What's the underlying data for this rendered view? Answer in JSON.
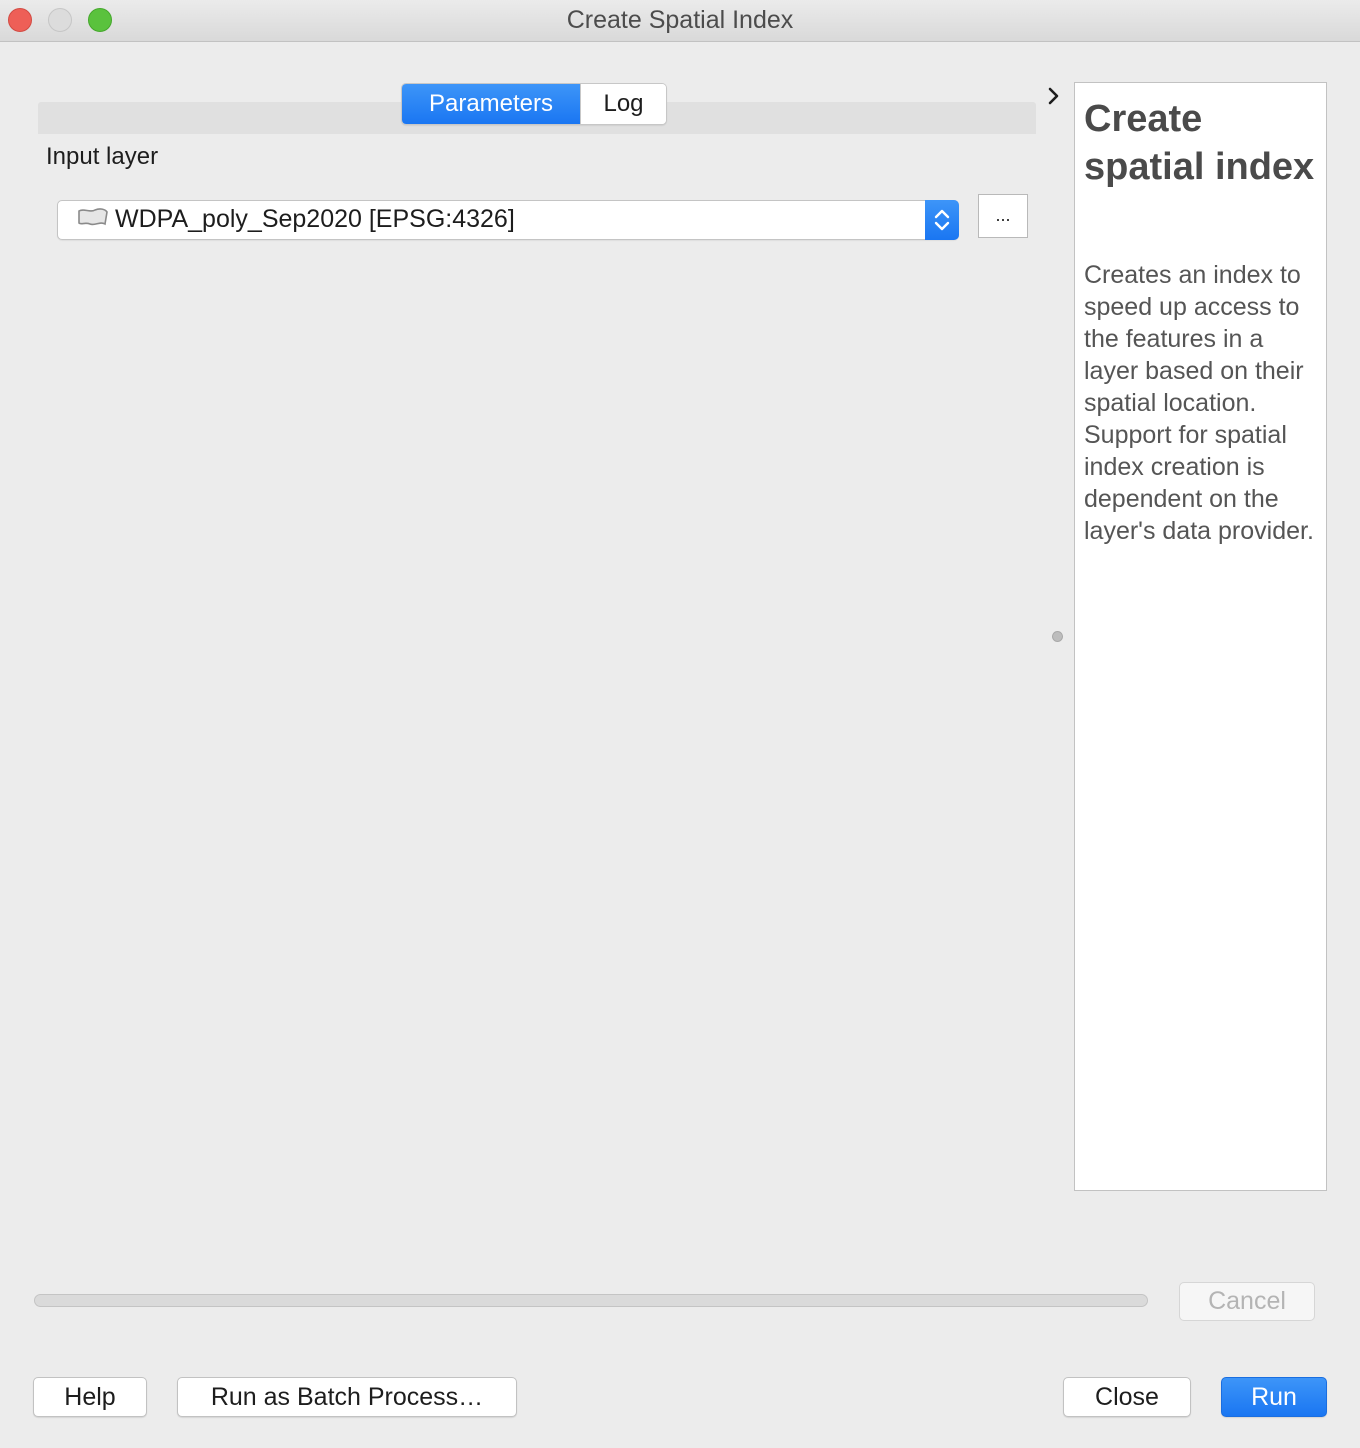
{
  "window": {
    "title": "Create Spatial Index"
  },
  "tabs": [
    {
      "label": "Parameters",
      "active": true
    },
    {
      "label": "Log",
      "active": false
    }
  ],
  "parameters": {
    "input_layer_label": "Input layer",
    "input_layer_value": "WDPA_poly_Sep2020 [EPSG:4326]",
    "input_layer_icon": "polygon-layer-icon",
    "browse_button_label": "..."
  },
  "help_panel": {
    "title": "Create spatial index",
    "description": "Creates an index to speed up access to the features in a layer based on their spatial location. Support for spatial index creation is dependent on the layer's data provider."
  },
  "progress": {
    "value": 0,
    "cancel_label": "Cancel"
  },
  "buttons": {
    "help": "Help",
    "batch": "Run as Batch Process…",
    "close": "Close",
    "run": "Run"
  },
  "colors": {
    "accent": "#1a76f2",
    "close_light": "#ee5f57",
    "maximize_light": "#5ac23d",
    "minimize_light": "#dcdcdc"
  }
}
